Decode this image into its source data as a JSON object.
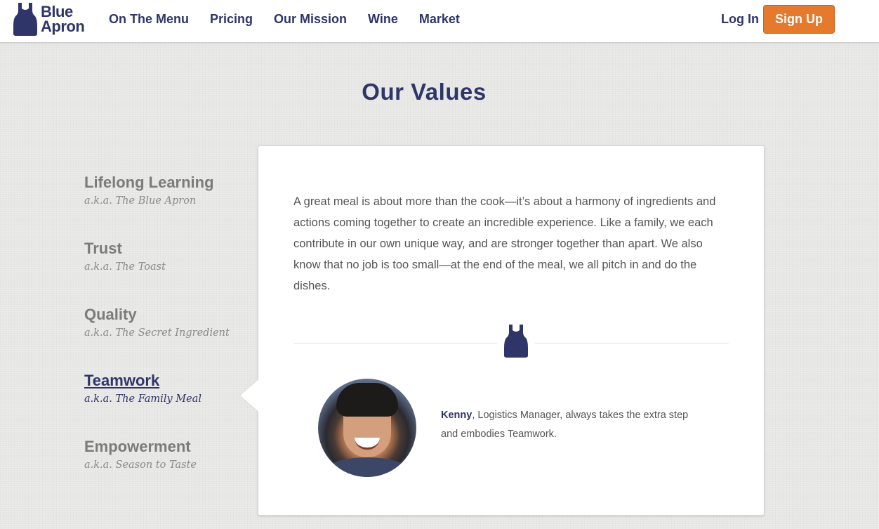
{
  "brand": {
    "line1": "Blue",
    "line2": "Apron",
    "color": "#2f3568"
  },
  "nav": {
    "items": [
      "On The Menu",
      "Pricing",
      "Our Mission",
      "Wine",
      "Market"
    ],
    "login": "Log In",
    "signup": "Sign Up",
    "signup_color": "#e5792d"
  },
  "section": {
    "title": "Our Values"
  },
  "values": [
    {
      "name": "Lifelong Learning",
      "aka": "a.k.a. The Blue Apron",
      "active": false
    },
    {
      "name": "Trust",
      "aka": "a.k.a. The Toast",
      "active": false
    },
    {
      "name": "Quality",
      "aka": "a.k.a. The Secret Ingredient",
      "active": false
    },
    {
      "name": "Teamwork",
      "aka": "a.k.a. The Family Meal",
      "active": true
    },
    {
      "name": "Empowerment",
      "aka": "a.k.a. Season to Taste",
      "active": false
    }
  ],
  "detail": {
    "description": "A great meal is about more than the cook—it’s about a harmony of ingredients and actions coming together to create an incredible experience. Like a family, we each contribute in our own unique way, and are stronger together than apart. We also know that no job is too small—at the end of the meal, we all pitch in and do the dishes.",
    "divider_icon": "apron-icon",
    "person_name": "Kenny",
    "person_text": ", Logistics Manager, always takes the extra step and embodies Teamwork."
  }
}
